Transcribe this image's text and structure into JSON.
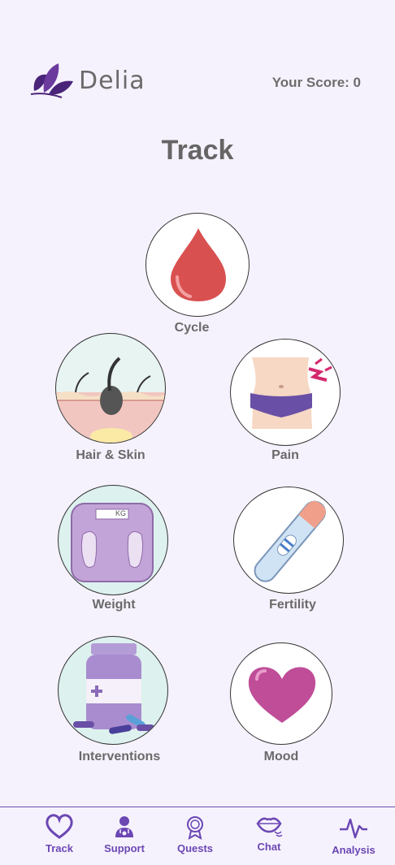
{
  "header": {
    "logo_text": "Delia",
    "score_label": "Your Score: 0"
  },
  "page_title": "Track",
  "categories": [
    {
      "label": "Cycle",
      "icon": "blood-drop-icon"
    },
    {
      "label": "Hair & Skin",
      "icon": "hair-skin-icon"
    },
    {
      "label": "Pain",
      "icon": "abdominal-pain-icon"
    },
    {
      "label": "Weight",
      "icon": "scale-icon"
    },
    {
      "label": "Fertility",
      "icon": "pregnancy-test-icon"
    },
    {
      "label": "Interventions",
      "icon": "medication-icon"
    },
    {
      "label": "Mood",
      "icon": "heart-icon"
    }
  ],
  "scale_unit": "KG",
  "nav": [
    {
      "label": "Track",
      "icon": "heart-outline-icon"
    },
    {
      "label": "Support",
      "icon": "doctor-icon"
    },
    {
      "label": "Quests",
      "icon": "badge-icon"
    },
    {
      "label": "Chat",
      "icon": "chat-lips-icon"
    },
    {
      "label": "Analysis",
      "icon": "pulse-icon"
    }
  ],
  "colors": {
    "background": "#f6f2fd",
    "accent": "#6b47b4",
    "logo_purple": "#4a2478"
  }
}
